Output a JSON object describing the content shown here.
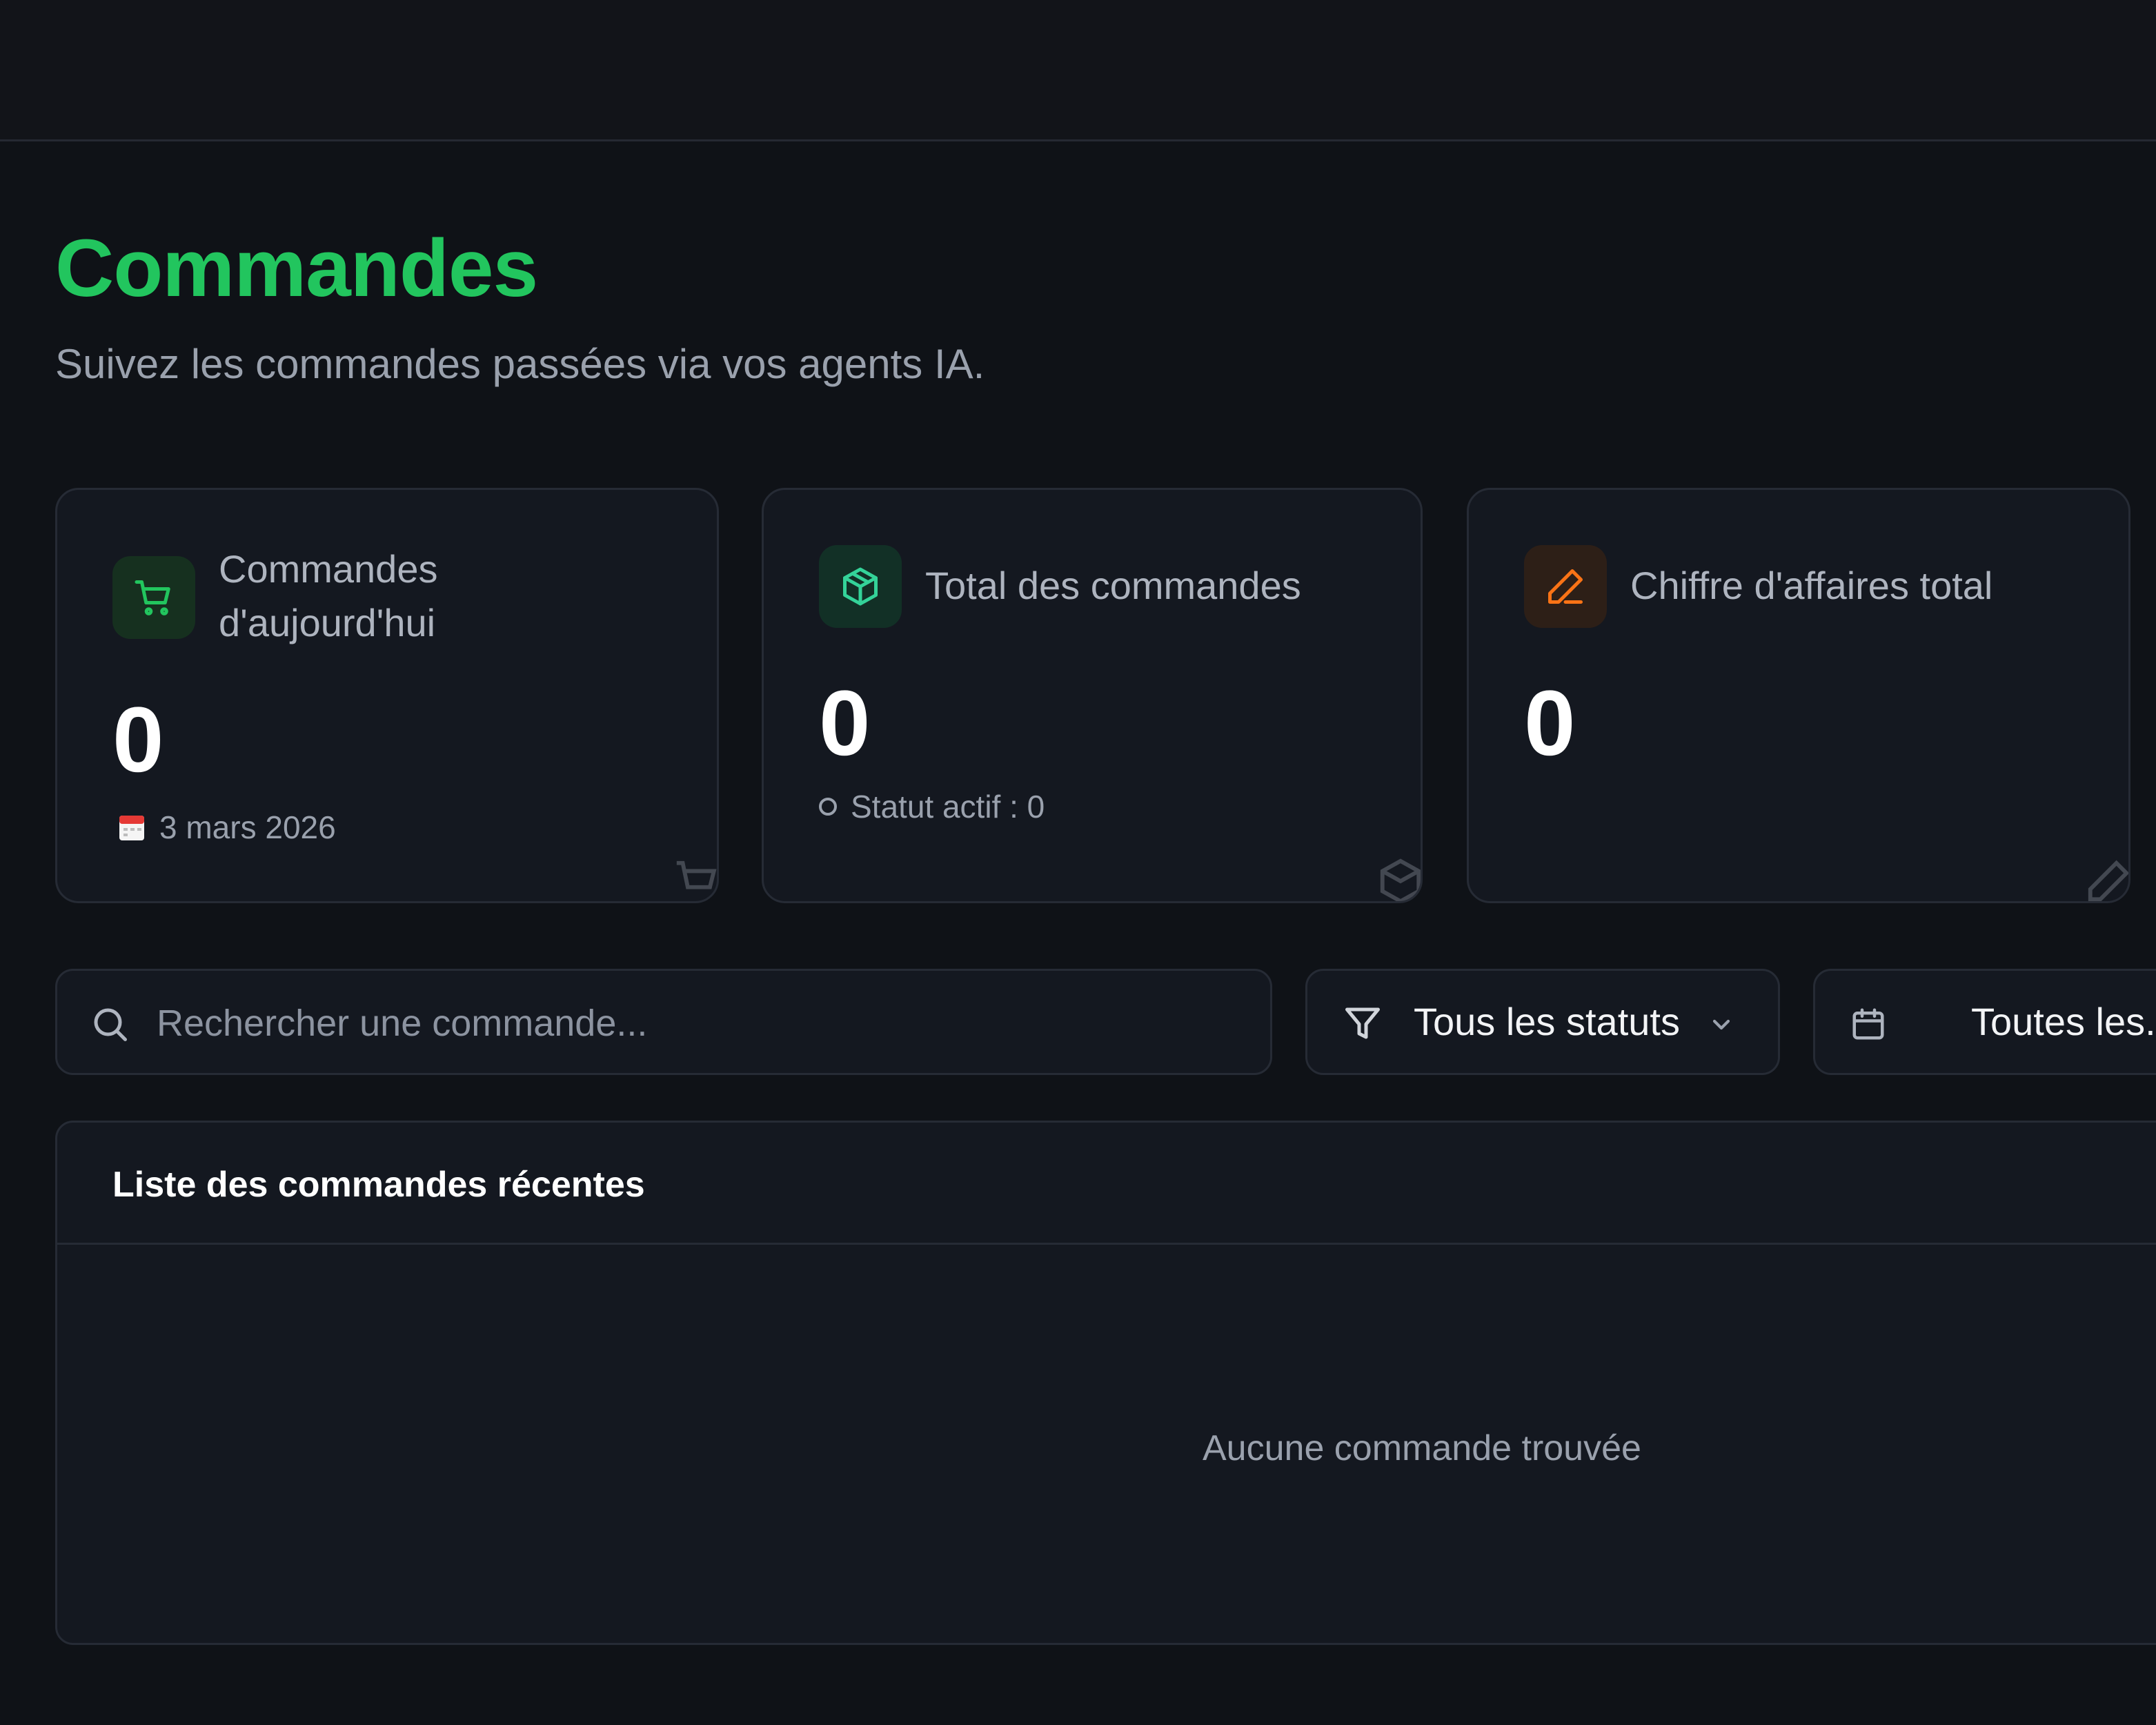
{
  "page": {
    "title": "Commandes",
    "subtitle": "Suivez les commandes passées via vos agents IA."
  },
  "stats": [
    {
      "label_line1": "Commandes",
      "label_line2": "d'aujourd'hui",
      "value": "0",
      "sub": "3 mars 2026",
      "icon": "shopping-cart-icon",
      "accent": "#22c55e"
    },
    {
      "label": "Total des commandes",
      "value": "0",
      "sub": "Statut actif : 0",
      "icon": "package-icon",
      "accent": "#34d399"
    },
    {
      "label": "Chiffre d'affaires total",
      "value": "0",
      "icon": "pencil-icon",
      "accent": "#f97316"
    }
  ],
  "search": {
    "placeholder": "Rechercher une commande..."
  },
  "filters": {
    "status_selected": "Tous les statuts",
    "date_selected": "Toutes les..."
  },
  "orders": {
    "title": "Liste des commandes récentes",
    "empty_message": "Aucune commande trouvée"
  },
  "colors": {
    "accent_green": "#22c55e",
    "background": "#0f1217",
    "card_bg": "#141820",
    "border": "#262b35"
  }
}
